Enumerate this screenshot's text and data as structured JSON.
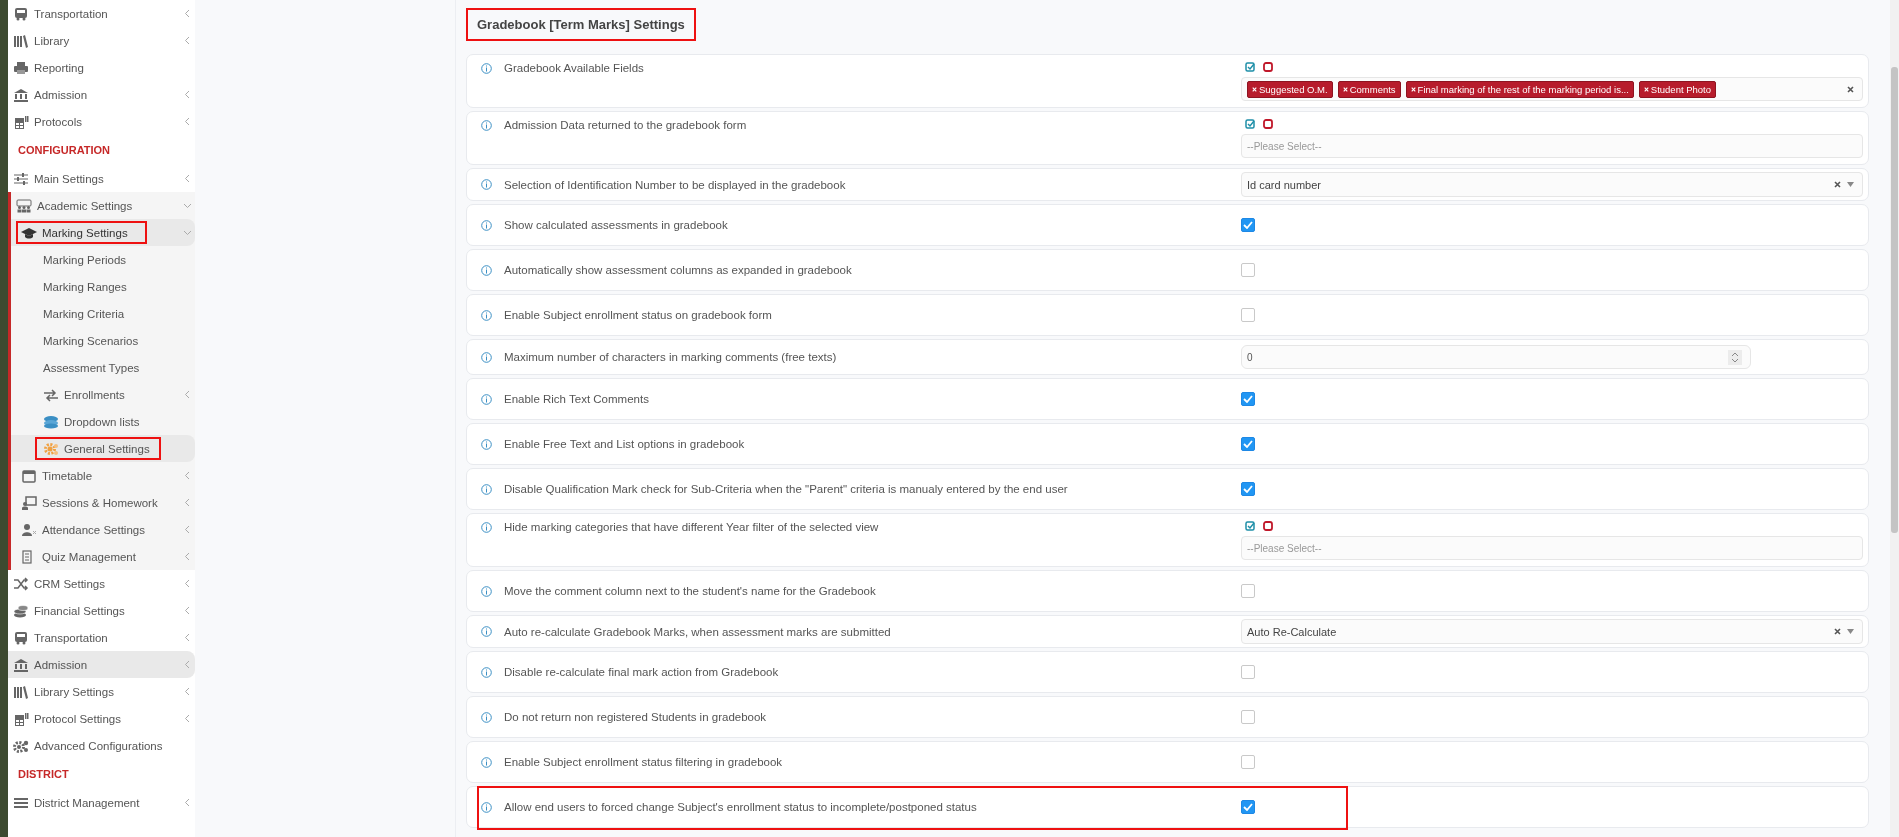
{
  "sidebar": {
    "sections": [
      {
        "items": [
          {
            "label": "Transportation",
            "expandable": true,
            "expanded": false,
            "selected": false,
            "highlighted": false
          },
          {
            "label": "Library",
            "expandable": true,
            "expanded": false,
            "selected": false,
            "highlighted": false
          },
          {
            "label": "Reporting",
            "expandable": false,
            "selected": false,
            "highlighted": false
          },
          {
            "label": "Admission",
            "expandable": true,
            "expanded": false,
            "selected": false,
            "highlighted": false
          },
          {
            "label": "Protocols",
            "expandable": true,
            "expanded": false,
            "selected": false,
            "highlighted": false
          }
        ]
      },
      {
        "header": "CONFIGURATION",
        "items": [
          {
            "label": "Main Settings",
            "expandable": true,
            "expanded": false,
            "selected": false,
            "highlighted": false
          },
          {
            "label": "Academic Settings",
            "expandable": true,
            "expanded": true,
            "selected": false,
            "highlighted": false,
            "children": [
              {
                "label": "Marking Settings",
                "expandable": true,
                "expanded": true,
                "selected": true,
                "highlighted": true,
                "children": [
                  {
                    "label": "Marking Periods",
                    "expandable": false,
                    "selected": false,
                    "highlighted": false
                  },
                  {
                    "label": "Marking Ranges",
                    "expandable": false,
                    "selected": false,
                    "highlighted": false
                  },
                  {
                    "label": "Marking Criteria",
                    "expandable": false,
                    "selected": false,
                    "highlighted": false
                  },
                  {
                    "label": "Marking Scenarios",
                    "expandable": false,
                    "selected": false,
                    "highlighted": false
                  },
                  {
                    "label": "Assessment Types",
                    "expandable": false,
                    "selected": false,
                    "highlighted": false
                  },
                  {
                    "label": "Enrollments",
                    "expandable": true,
                    "expanded": false,
                    "selected": false,
                    "highlighted": false
                  },
                  {
                    "label": "Dropdown lists",
                    "expandable": false,
                    "selected": false,
                    "highlighted": false
                  },
                  {
                    "label": "General Settings",
                    "expandable": false,
                    "selected": true,
                    "highlighted": true
                  }
                ]
              },
              {
                "label": "Timetable",
                "expandable": true,
                "expanded": false,
                "selected": false,
                "highlighted": false
              },
              {
                "label": "Sessions & Homework",
                "expandable": true,
                "expanded": false,
                "selected": false,
                "highlighted": false
              },
              {
                "label": "Attendance Settings",
                "expandable": true,
                "expanded": false,
                "selected": false,
                "highlighted": false
              },
              {
                "label": "Quiz Management",
                "expandable": true,
                "expanded": false,
                "selected": false,
                "highlighted": false
              }
            ]
          },
          {
            "label": "CRM Settings",
            "expandable": true,
            "expanded": false,
            "selected": false,
            "highlighted": false
          },
          {
            "label": "Financial Settings",
            "expandable": true,
            "expanded": false,
            "selected": false,
            "highlighted": false
          },
          {
            "label": "Transportation",
            "expandable": true,
            "expanded": false,
            "selected": false,
            "highlighted": false
          },
          {
            "label": "Admission",
            "expandable": true,
            "expanded": false,
            "selected": true,
            "highlighted": false
          },
          {
            "label": "Library Settings",
            "expandable": true,
            "expanded": false,
            "selected": false,
            "highlighted": false
          },
          {
            "label": "Protocol Settings",
            "expandable": true,
            "expanded": false,
            "selected": false,
            "highlighted": false
          },
          {
            "label": "Advanced Configurations",
            "expandable": false,
            "selected": false,
            "highlighted": false
          }
        ]
      },
      {
        "header": "DISTRICT",
        "items": [
          {
            "label": "District Management",
            "expandable": true,
            "expanded": false,
            "selected": false,
            "highlighted": false
          }
        ]
      }
    ]
  },
  "title": {
    "text": "Gradebook [Term Marks] Settings",
    "highlighted": true
  },
  "rows": [
    {
      "label": "Gradebook Available Fields",
      "kind": "tags",
      "tags": [
        "Suggested O.M.",
        "Comments",
        "Final marking of the rest of the marking period is...",
        "Student Photo"
      ],
      "highlighted": false
    },
    {
      "label": "Admission Data returned to the gradebook form",
      "kind": "multiselect",
      "placeholder": "--Please Select--",
      "highlighted": false
    },
    {
      "label": "Selection of Identification Number to be displayed in the gradebook",
      "kind": "select",
      "value": "Id card number",
      "highlighted": false
    },
    {
      "label": "Show calculated assessments in gradebook",
      "kind": "checkbox",
      "checked": true,
      "highlighted": false
    },
    {
      "label": "Automatically show assessment columns as expanded in gradebook",
      "kind": "checkbox",
      "checked": false,
      "highlighted": false
    },
    {
      "label": "Enable Subject enrollment status on gradebook form",
      "kind": "checkbox",
      "checked": false,
      "highlighted": false
    },
    {
      "label": "Maximum number of characters in marking comments (free texts)",
      "kind": "number",
      "value": "0",
      "highlighted": false
    },
    {
      "label": "Enable Rich Text Comments",
      "kind": "checkbox",
      "checked": true,
      "highlighted": false
    },
    {
      "label": "Enable Free Text and List options in gradebook",
      "kind": "checkbox",
      "checked": true,
      "highlighted": false
    },
    {
      "label": "Disable Qualification Mark check for Sub-Criteria when the \"Parent\" criteria is manualy entered by the end user",
      "kind": "checkbox",
      "checked": true,
      "highlighted": false
    },
    {
      "label": "Hide marking categories that have different Year filter of the selected view",
      "kind": "multiselect",
      "placeholder": "--Please Select--",
      "highlighted": false
    },
    {
      "label": "Move the comment column next to the student's name for the Gradebook",
      "kind": "checkbox",
      "checked": false,
      "highlighted": false
    },
    {
      "label": "Auto re-calculate Gradebook Marks, when assessment marks are submitted",
      "kind": "select",
      "value": "Auto Re-Calculate",
      "highlighted": false
    },
    {
      "label": "Disable re-calculate final mark action from Gradebook",
      "kind": "checkbox",
      "checked": false,
      "highlighted": false
    },
    {
      "label": "Do not return non registered Students in gradebook",
      "kind": "checkbox",
      "checked": false,
      "highlighted": false
    },
    {
      "label": "Enable Subject enrollment status filtering in gradebook",
      "kind": "checkbox",
      "checked": false,
      "highlighted": false
    },
    {
      "label": "Allow end users to forced change Subject's enrollment status to incomplete/postponed status",
      "kind": "checkbox",
      "checked": true,
      "highlighted": true
    }
  ]
}
